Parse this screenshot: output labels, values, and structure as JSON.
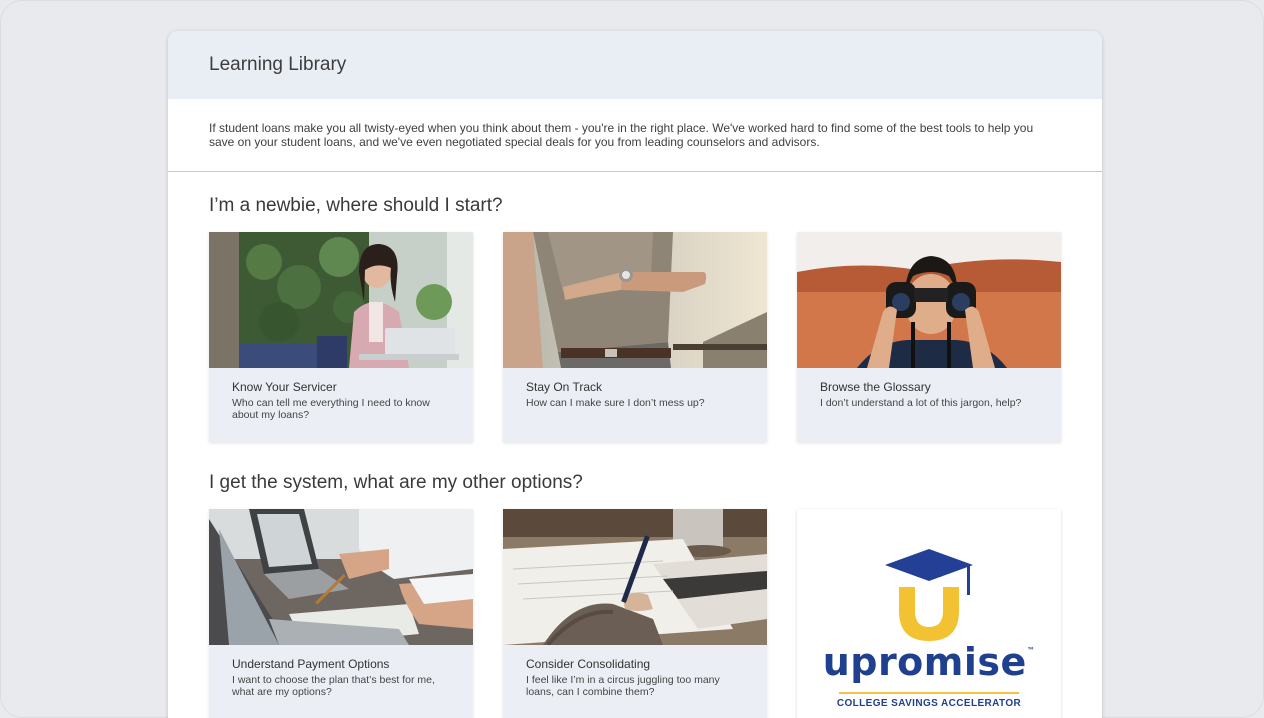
{
  "library": {
    "title": "Learning Library",
    "intro": "If student loans make you all twisty-eyed when you think about them - you're in the right place. We've worked hard to find some of the best tools to help you save on your student loans, and we've even negotiated special deals for you from leading counselors and advisors."
  },
  "sections": [
    {
      "heading": "I’m a newbie, where should I start?",
      "cards": [
        {
          "title": "Know Your Servicer",
          "desc": "Who can tell me everything I need to know about my loans?",
          "image": "woman-on-phone-at-laptop"
        },
        {
          "title": "Stay On Track",
          "desc": "How can I make sure I don’t mess up?",
          "image": "man-checking-wristwatch"
        },
        {
          "title": "Browse the Glossary",
          "desc": "I don’t understand a lot of this jargon, help?",
          "image": "man-with-binoculars"
        }
      ]
    },
    {
      "heading": "I get the system, what are my other options?",
      "cards": [
        {
          "title": "Understand Payment Options",
          "desc": "I want to choose the plan that’s best for me, what are my options?",
          "image": "hands-writing-at-laptop"
        },
        {
          "title": "Consider Consolidating",
          "desc": "I feel like I’m in a circus juggling too many loans, can I combine them?",
          "image": "hand-writing-with-pen"
        }
      ],
      "promo": {
        "brand": "upromise",
        "trademark": "™",
        "tagline": "COLLEGE SAVINGS ACCELERATOR"
      }
    }
  ],
  "colors": {
    "header_bg": "#e9eef5",
    "card_bg": "#ebeff5",
    "divider": "#a9d3d6",
    "upromise_blue": "#1f3f8f",
    "upromise_yellow": "#f2c644"
  }
}
